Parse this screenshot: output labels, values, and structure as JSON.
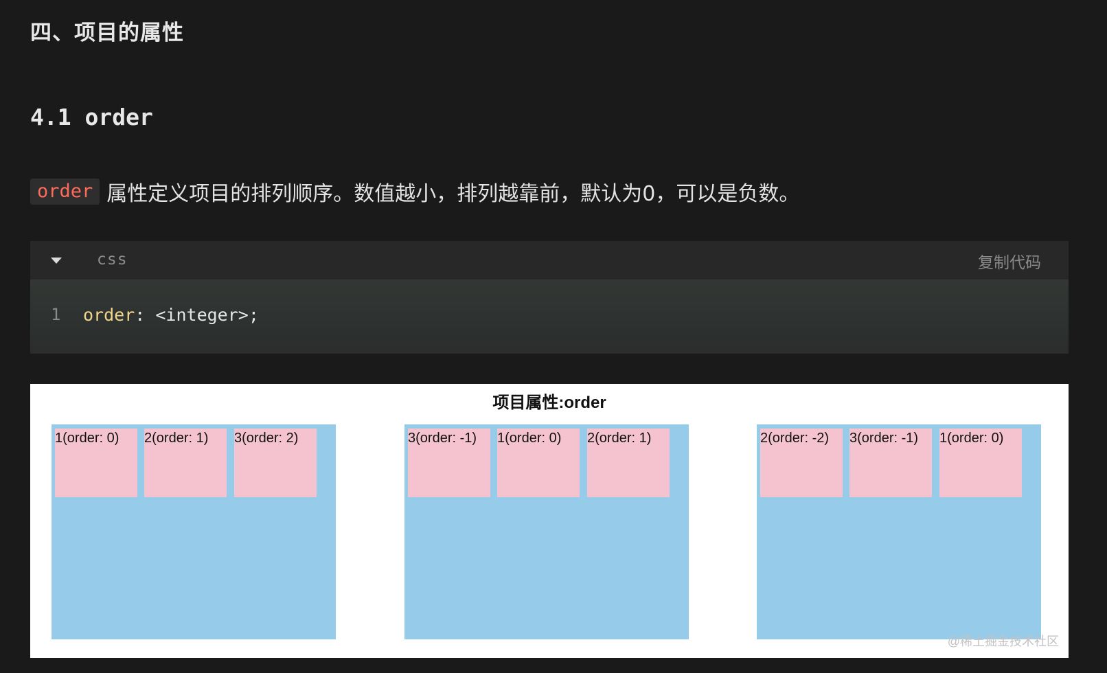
{
  "heading": {
    "section": "四、项目的属性",
    "subsection": "4.1 order"
  },
  "paragraph": {
    "code": "order",
    "text": "属性定义项目的排列顺序。数值越小，排列越靠前，默认为0，可以是负数。"
  },
  "code_block": {
    "language": "css",
    "copy_label": "复制代码",
    "lines": [
      {
        "number": "1",
        "property": "order",
        "rest": ": <integer>;"
      }
    ]
  },
  "demo": {
    "title": "项目属性:order",
    "containers": [
      {
        "items": [
          "1(order: 0)",
          "2(order: 1)",
          "3(order: 2)"
        ]
      },
      {
        "items": [
          "3(order: -1)",
          "1(order: 0)",
          "2(order: 1)"
        ]
      },
      {
        "items": [
          "2(order: -2)",
          "3(order: -1)",
          "1(order: 0)"
        ]
      }
    ],
    "watermark": "@稀土掘金技术社区"
  },
  "colors": {
    "page_background": "#1a1a1a",
    "inline_code": "#ff6b5a",
    "keyword": "#f0d58a",
    "container": "#96cbea",
    "item": "#f4c3cf"
  }
}
